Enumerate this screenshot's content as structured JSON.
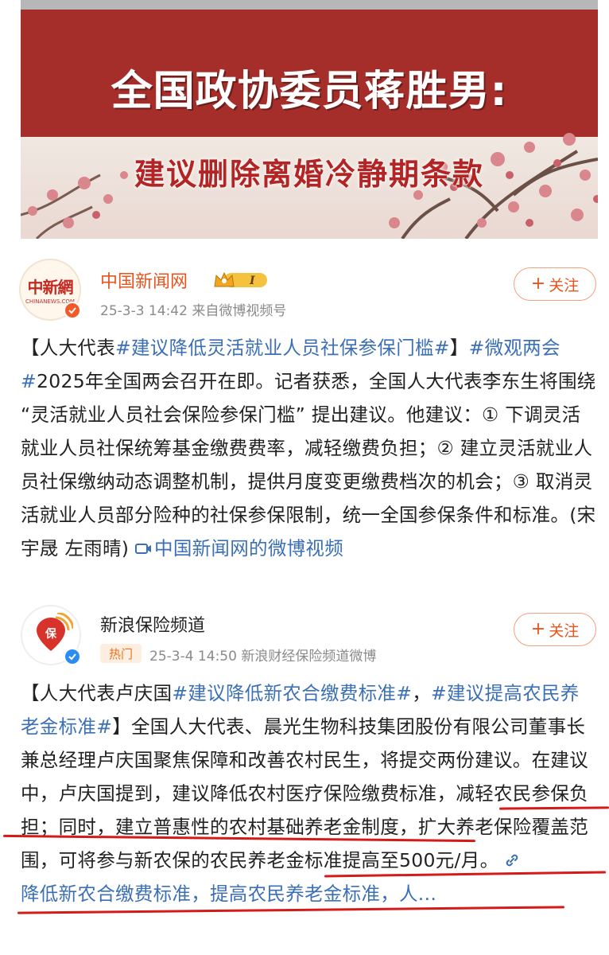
{
  "banner": {
    "title": "全国政协委员蒋胜男:",
    "subtitle": "建议删除离婚冷静期条款"
  },
  "post1": {
    "username": "中国新闻网",
    "vip_level": "I",
    "avatar_cn": "中新網",
    "avatar_en": "CHINANEWS.COM",
    "meta": "25-3-3 14:42  来自微博视频号",
    "follow_label": "关注",
    "text_seg1": "【人大代表",
    "topic1": "#建议降低灵活就业人员社保参保门槛#",
    "text_seg2": "】",
    "topic2": "#微观两会#",
    "text_seg3": "2025年全国两会召开在即。记者获悉，全国人大代表李东生将围绕 “灵活就业人员社会保险参保门槛” 提出建议。他建议：① 下调灵活就业人员社保统筹基金缴费费率，减轻缴费负担；② 建立灵活就业人员社保缴纳动态调整机制，提供月度变更缴费档次的机会；③ 取消灵活就业人员部分险种的社保参保限制，统一全国参保条件和标准。(宋宇晟 左雨晴) ",
    "video_link": "中国新闻网的微博视频"
  },
  "post2": {
    "username": "新浪保险频道",
    "hot_tag": "热门",
    "meta": "25-3-4 14:50  新浪财经保险频道微博",
    "follow_label": "关注",
    "text_seg1": "【人大代表卢庆国",
    "topic1": "#建议降低新农合缴费标准#",
    "text_seg2": "，",
    "topic2": "#建议提高农民养老金标准#",
    "text_seg3": "】全国人大代表、晨光生物科技集团股份有限公司董事长兼总经理卢庆国聚焦保障和改善农村民生，将提交两份建议。在建议中，卢庆国提到，建议降低农村医疗保险缴费标准，减轻农民参保负担；同时，建立普惠性的农村基础养老金制度，扩大养老保险覆盖范围，可将参与新农保的农民养老金标准提高至500元/月。",
    "link_text": "降低新农合缴费标准，提高农民养老金标准，人..."
  },
  "colors": {
    "accent_orange": "#e8541e",
    "link_blue": "#3b6fb6",
    "annotation_red": "#d51a1a",
    "banner_red": "#a52e2a"
  }
}
